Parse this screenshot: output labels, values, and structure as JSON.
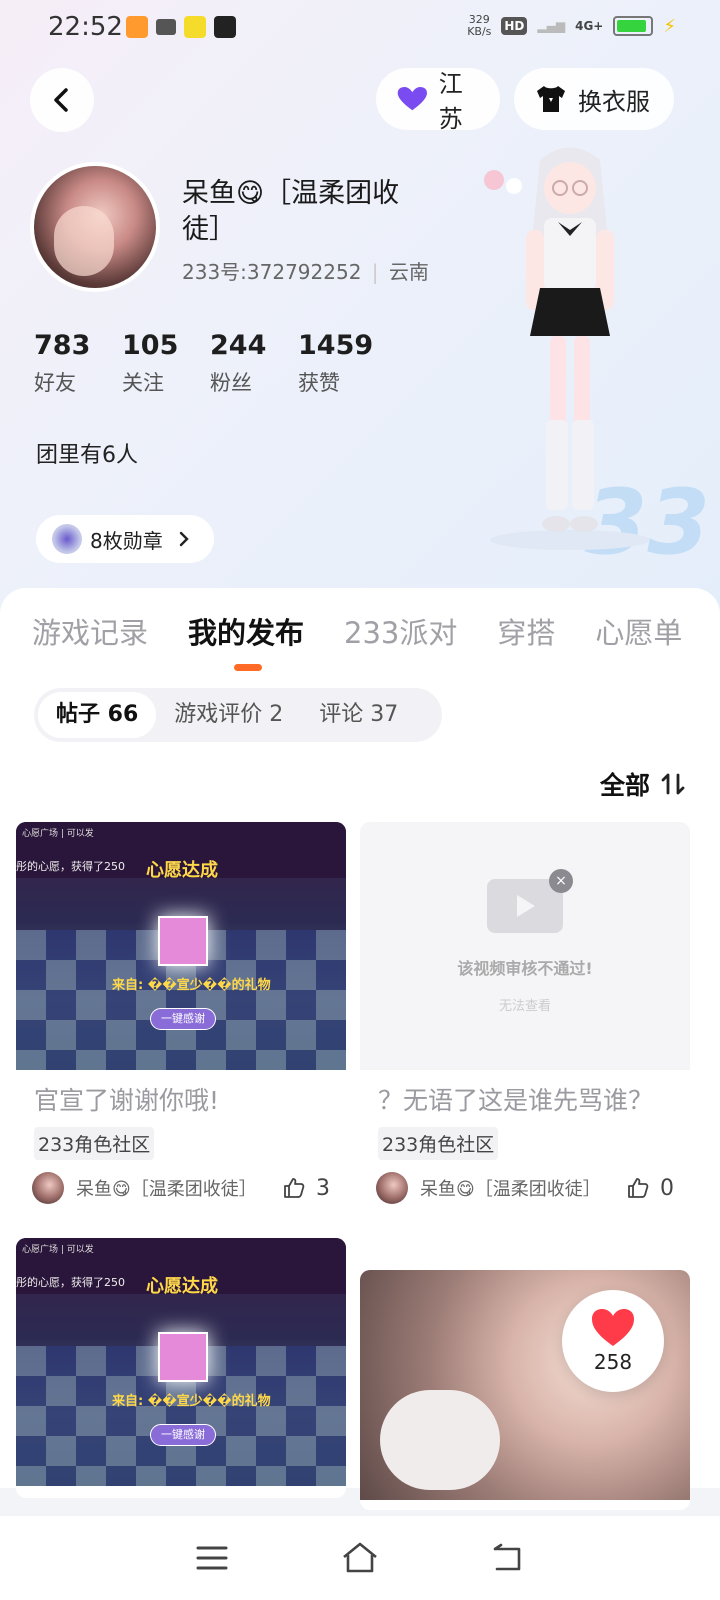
{
  "status_bar": {
    "time": "22:52",
    "net_speed_value": "329",
    "net_speed_unit": "KB/s",
    "hd": "HD",
    "signal": "4G+",
    "battery_level": 0.9
  },
  "header": {
    "region_label": "江苏",
    "outfit_label": "换衣服"
  },
  "profile": {
    "name": "呆鱼😋［温柔团收徒］",
    "id_text": "233号:372792252",
    "location": "云南",
    "stats": [
      {
        "num": "783",
        "label": "好友"
      },
      {
        "num": "105",
        "label": "关注"
      },
      {
        "num": "244",
        "label": "粉丝"
      },
      {
        "num": "1459",
        "label": "获赞"
      }
    ],
    "group_info": "团里有6人",
    "medal_label": "8枚勋章"
  },
  "tabs": [
    "游戏记录",
    "我的发布",
    "233派对",
    "穿搭",
    "心愿单"
  ],
  "active_tab": "我的发布",
  "subtabs": [
    "帖子 66",
    "游戏评价 2",
    "评论 37"
  ],
  "sort_label": "全部",
  "posts": [
    {
      "title": "官宣了谢谢你哦!",
      "tag": "233角色社区",
      "author": "呆鱼😋［温柔团收徒］",
      "likes": "3",
      "image": {
        "wish_title": "心愿达成",
        "caption": "彤的心愿，获得了250",
        "from": "来自: ��宣少��的礼物",
        "thank": "一键感谢",
        "note": "心愿广场 | 可以发"
      }
    },
    {
      "title": "？无语了这是谁先骂谁？",
      "tag": "233角色社区",
      "author": "呆鱼😋［温柔团收徒］",
      "likes": "0",
      "image": {
        "failed": "该视频审核不通过!",
        "failed_sub": "无法查看"
      }
    },
    {
      "image": {
        "wish_title": "心愿达成",
        "caption": "彤的心愿，获得了250",
        "from": "来自: ��宣少��的礼物",
        "thank": "一键感谢",
        "note": "心愿广场 | 可以发"
      }
    }
  ],
  "heart_count": "258",
  "hero_watermark": "33"
}
